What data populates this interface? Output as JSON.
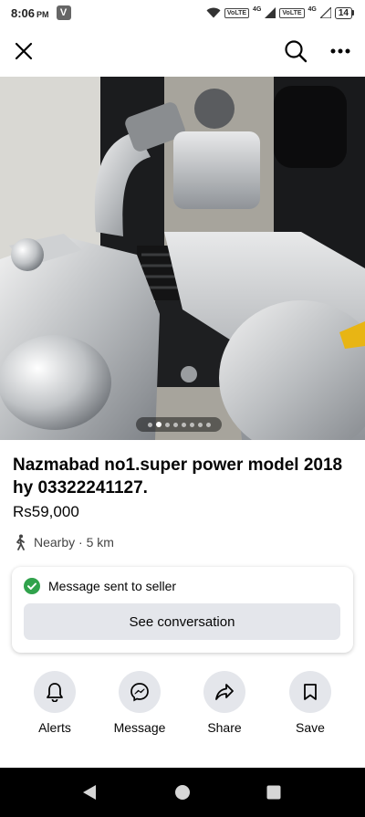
{
  "status_bar": {
    "time": "8:06",
    "ampm": "PM",
    "app_icon": "V",
    "signal_tags": [
      "VoLTE",
      "4G",
      "VoLTE",
      "4G"
    ],
    "battery": "14"
  },
  "header": {
    "close_icon": "close-icon",
    "search_icon": "search-icon",
    "more_icon": "more-options-icon"
  },
  "photo": {
    "carousel_dot_count": 8,
    "carousel_active_index": 1
  },
  "listing": {
    "title": "Nazmabad no1.super power model 2018 hy 03322241127.",
    "price": "Rs59,000",
    "location": "Nearby · 5 km"
  },
  "message_card": {
    "status": "Message sent to seller",
    "button_label": "See conversation"
  },
  "actions": [
    {
      "label": "Alerts",
      "icon": "bell-icon"
    },
    {
      "label": "Message",
      "icon": "messenger-icon"
    },
    {
      "label": "Share",
      "icon": "share-icon"
    },
    {
      "label": "Save",
      "icon": "bookmark-icon"
    }
  ],
  "colors": {
    "button_bg": "#e4e6eb",
    "success_green": "#31a24c",
    "text_primary": "#050505",
    "nav_bar_bg": "#000000"
  }
}
